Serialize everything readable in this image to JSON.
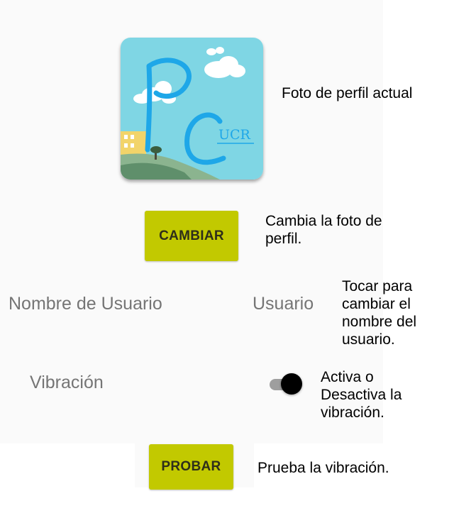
{
  "profile": {
    "avatar_icon": "pc-ucr-logo-icon",
    "avatar_text": "PC",
    "avatar_subtext": "UCR",
    "avatar_annotation": "Foto de perfil actual"
  },
  "change_photo": {
    "button_label": "CAMBIAR",
    "annotation": "Cambia la foto de perfil."
  },
  "username": {
    "label": "Nombre de Usuario",
    "value": "Usuario",
    "annotation": "Tocar para cambiar el nombre del usuario."
  },
  "vibration": {
    "label": "Vibración",
    "enabled": true,
    "annotation": "Activa o Desactiva la vibración."
  },
  "test": {
    "button_label": "PROBAR",
    "annotation": "Prueba la vibración."
  },
  "colors": {
    "button": "#c2c900",
    "avatar_sky": "#7fd6e4",
    "avatar_letters": "#1ea7e8"
  }
}
